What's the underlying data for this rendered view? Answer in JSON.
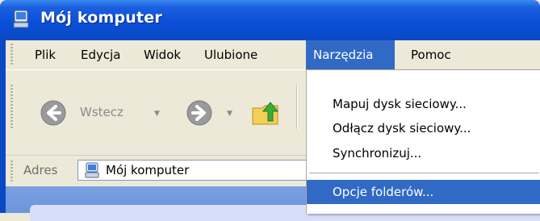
{
  "window": {
    "title": "Mój komputer",
    "title_icon": "my-computer-icon"
  },
  "menubar": {
    "items": [
      {
        "label": "Plik"
      },
      {
        "label": "Edycja"
      },
      {
        "label": "Widok"
      },
      {
        "label": "Ulubione"
      },
      {
        "label": "Narzędzia",
        "active": true
      },
      {
        "label": "Pomoc"
      }
    ]
  },
  "toolbar": {
    "back_label": "Wstecz",
    "back_icon": "back-arrow-icon",
    "forward_icon": "forward-arrow-icon",
    "up_icon": "folder-up-icon"
  },
  "addressbar": {
    "label": "Adres",
    "value": "Mój komputer",
    "icon": "my-computer-icon"
  },
  "tools_menu": {
    "items": [
      {
        "label": "Mapuj dysk sieciowy..."
      },
      {
        "label": "Odłącz dysk sieciowy..."
      },
      {
        "label": "Synchronizuj..."
      },
      {
        "label": "Opcje folderów...",
        "highlighted": true
      }
    ]
  },
  "colors": {
    "titlebar": "#0a4fd8",
    "menu_highlight": "#316ac5",
    "chrome": "#ece9d8"
  }
}
